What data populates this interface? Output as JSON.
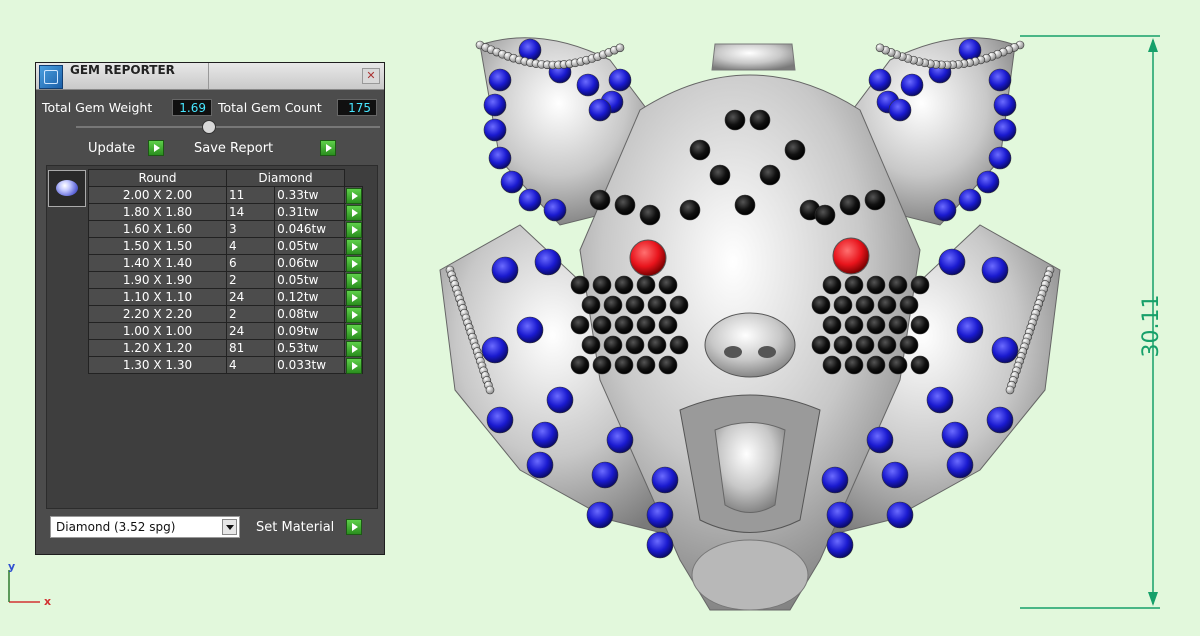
{
  "panel": {
    "title": "GEM REPORTER",
    "close_glyph": "✕",
    "total_weight_label": "Total Gem Weight",
    "total_weight_value": "1.69",
    "total_count_label": "Total Gem Count",
    "total_count_value": "175",
    "update_label": "Update",
    "save_report_label": "Save Report",
    "table_header_shape": "Round",
    "table_header_material": "Diamond",
    "rows": [
      {
        "size": "2.00 X 2.00",
        "count": "11",
        "weight": "0.33tw"
      },
      {
        "size": "1.80 X 1.80",
        "count": "14",
        "weight": "0.31tw"
      },
      {
        "size": "1.60 X 1.60",
        "count": "3",
        "weight": "0.046tw"
      },
      {
        "size": "1.50 X 1.50",
        "count": "4",
        "weight": "0.05tw"
      },
      {
        "size": "1.40 X 1.40",
        "count": "6",
        "weight": "0.06tw"
      },
      {
        "size": "1.90 X 1.90",
        "count": "2",
        "weight": "0.05tw"
      },
      {
        "size": "1.10 X 1.10",
        "count": "24",
        "weight": "0.12tw"
      },
      {
        "size": "2.20 X 2.20",
        "count": "2",
        "weight": "0.08tw"
      },
      {
        "size": "1.00 X 1.00",
        "count": "24",
        "weight": "0.09tw"
      },
      {
        "size": "1.20 X 1.20",
        "count": "81",
        "weight": "0.53tw"
      },
      {
        "size": "1.30 X 1.30",
        "count": "4",
        "weight": "0.033tw"
      }
    ],
    "material_select_value": "Diamond     (3.52 spg)",
    "set_material_label": "Set Material"
  },
  "viewport": {
    "dimension_value": "30.11",
    "axis_y_label": "y",
    "axis_x_label": "x"
  },
  "colors": {
    "background": "#e2f8dc",
    "accent_cyan": "#47e6ff",
    "go_green": "#3aae2c",
    "dimension_green": "#16a06a",
    "gem_blue": "#1a1ad0",
    "eye_red": "#e8141c"
  }
}
